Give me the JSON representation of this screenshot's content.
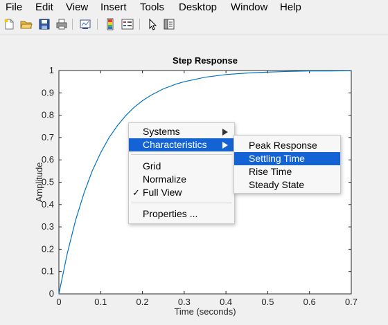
{
  "menubar": {
    "items": [
      "File",
      "Edit",
      "View",
      "Insert",
      "Tools",
      "Desktop",
      "Window",
      "Help"
    ]
  },
  "toolbar": {
    "icons": [
      "new-figure-icon",
      "open-file-icon",
      "save-icon",
      "print-icon",
      "link-plot-icon",
      "insert-colorbar-icon",
      "insert-legend-icon",
      "edit-plot-icon",
      "property-inspector-icon"
    ]
  },
  "colors": {
    "series": "#0072bd",
    "highlight": "#1463d4"
  },
  "chart_data": {
    "type": "line",
    "title": "Step Response",
    "xlabel": "Time (seconds)",
    "ylabel": "Amplitude",
    "xlim": [
      0,
      0.7
    ],
    "ylim": [
      0,
      1
    ],
    "xticks": [
      "0",
      "0.1",
      "0.2",
      "0.3",
      "0.4",
      "0.5",
      "0.6",
      "0.7"
    ],
    "yticks": [
      "0",
      "0.1",
      "0.2",
      "0.3",
      "0.4",
      "0.5",
      "0.6",
      "0.7",
      "0.8",
      "0.9",
      "1"
    ],
    "grid": false,
    "series": [
      {
        "x": [
          0,
          0.02,
          0.04,
          0.06,
          0.08,
          0.1,
          0.12,
          0.14,
          0.16,
          0.18,
          0.2,
          0.22,
          0.25,
          0.28,
          0.3,
          0.35,
          0.4,
          0.45,
          0.5,
          0.55,
          0.6,
          0.65,
          0.7
        ],
        "y": [
          0,
          0.181,
          0.33,
          0.451,
          0.551,
          0.632,
          0.699,
          0.753,
          0.798,
          0.835,
          0.865,
          0.889,
          0.918,
          0.939,
          0.95,
          0.97,
          0.982,
          0.989,
          0.993,
          0.996,
          0.998,
          0.998,
          0.999
        ]
      }
    ],
    "reference_line": 1
  },
  "context_menu": {
    "items": [
      {
        "label": "Systems",
        "submenu": true
      },
      {
        "label": "Characteristics",
        "submenu": true,
        "highlighted": true
      },
      {
        "label": "Grid"
      },
      {
        "label": "Normalize"
      },
      {
        "label": "Full View",
        "checked": true
      },
      {
        "label": "Properties ..."
      }
    ],
    "check_mark": "✓"
  },
  "submenu": {
    "items": [
      {
        "label": "Peak Response"
      },
      {
        "label": "Settling Time",
        "highlighted": true
      },
      {
        "label": "Rise Time"
      },
      {
        "label": "Steady State"
      }
    ]
  }
}
